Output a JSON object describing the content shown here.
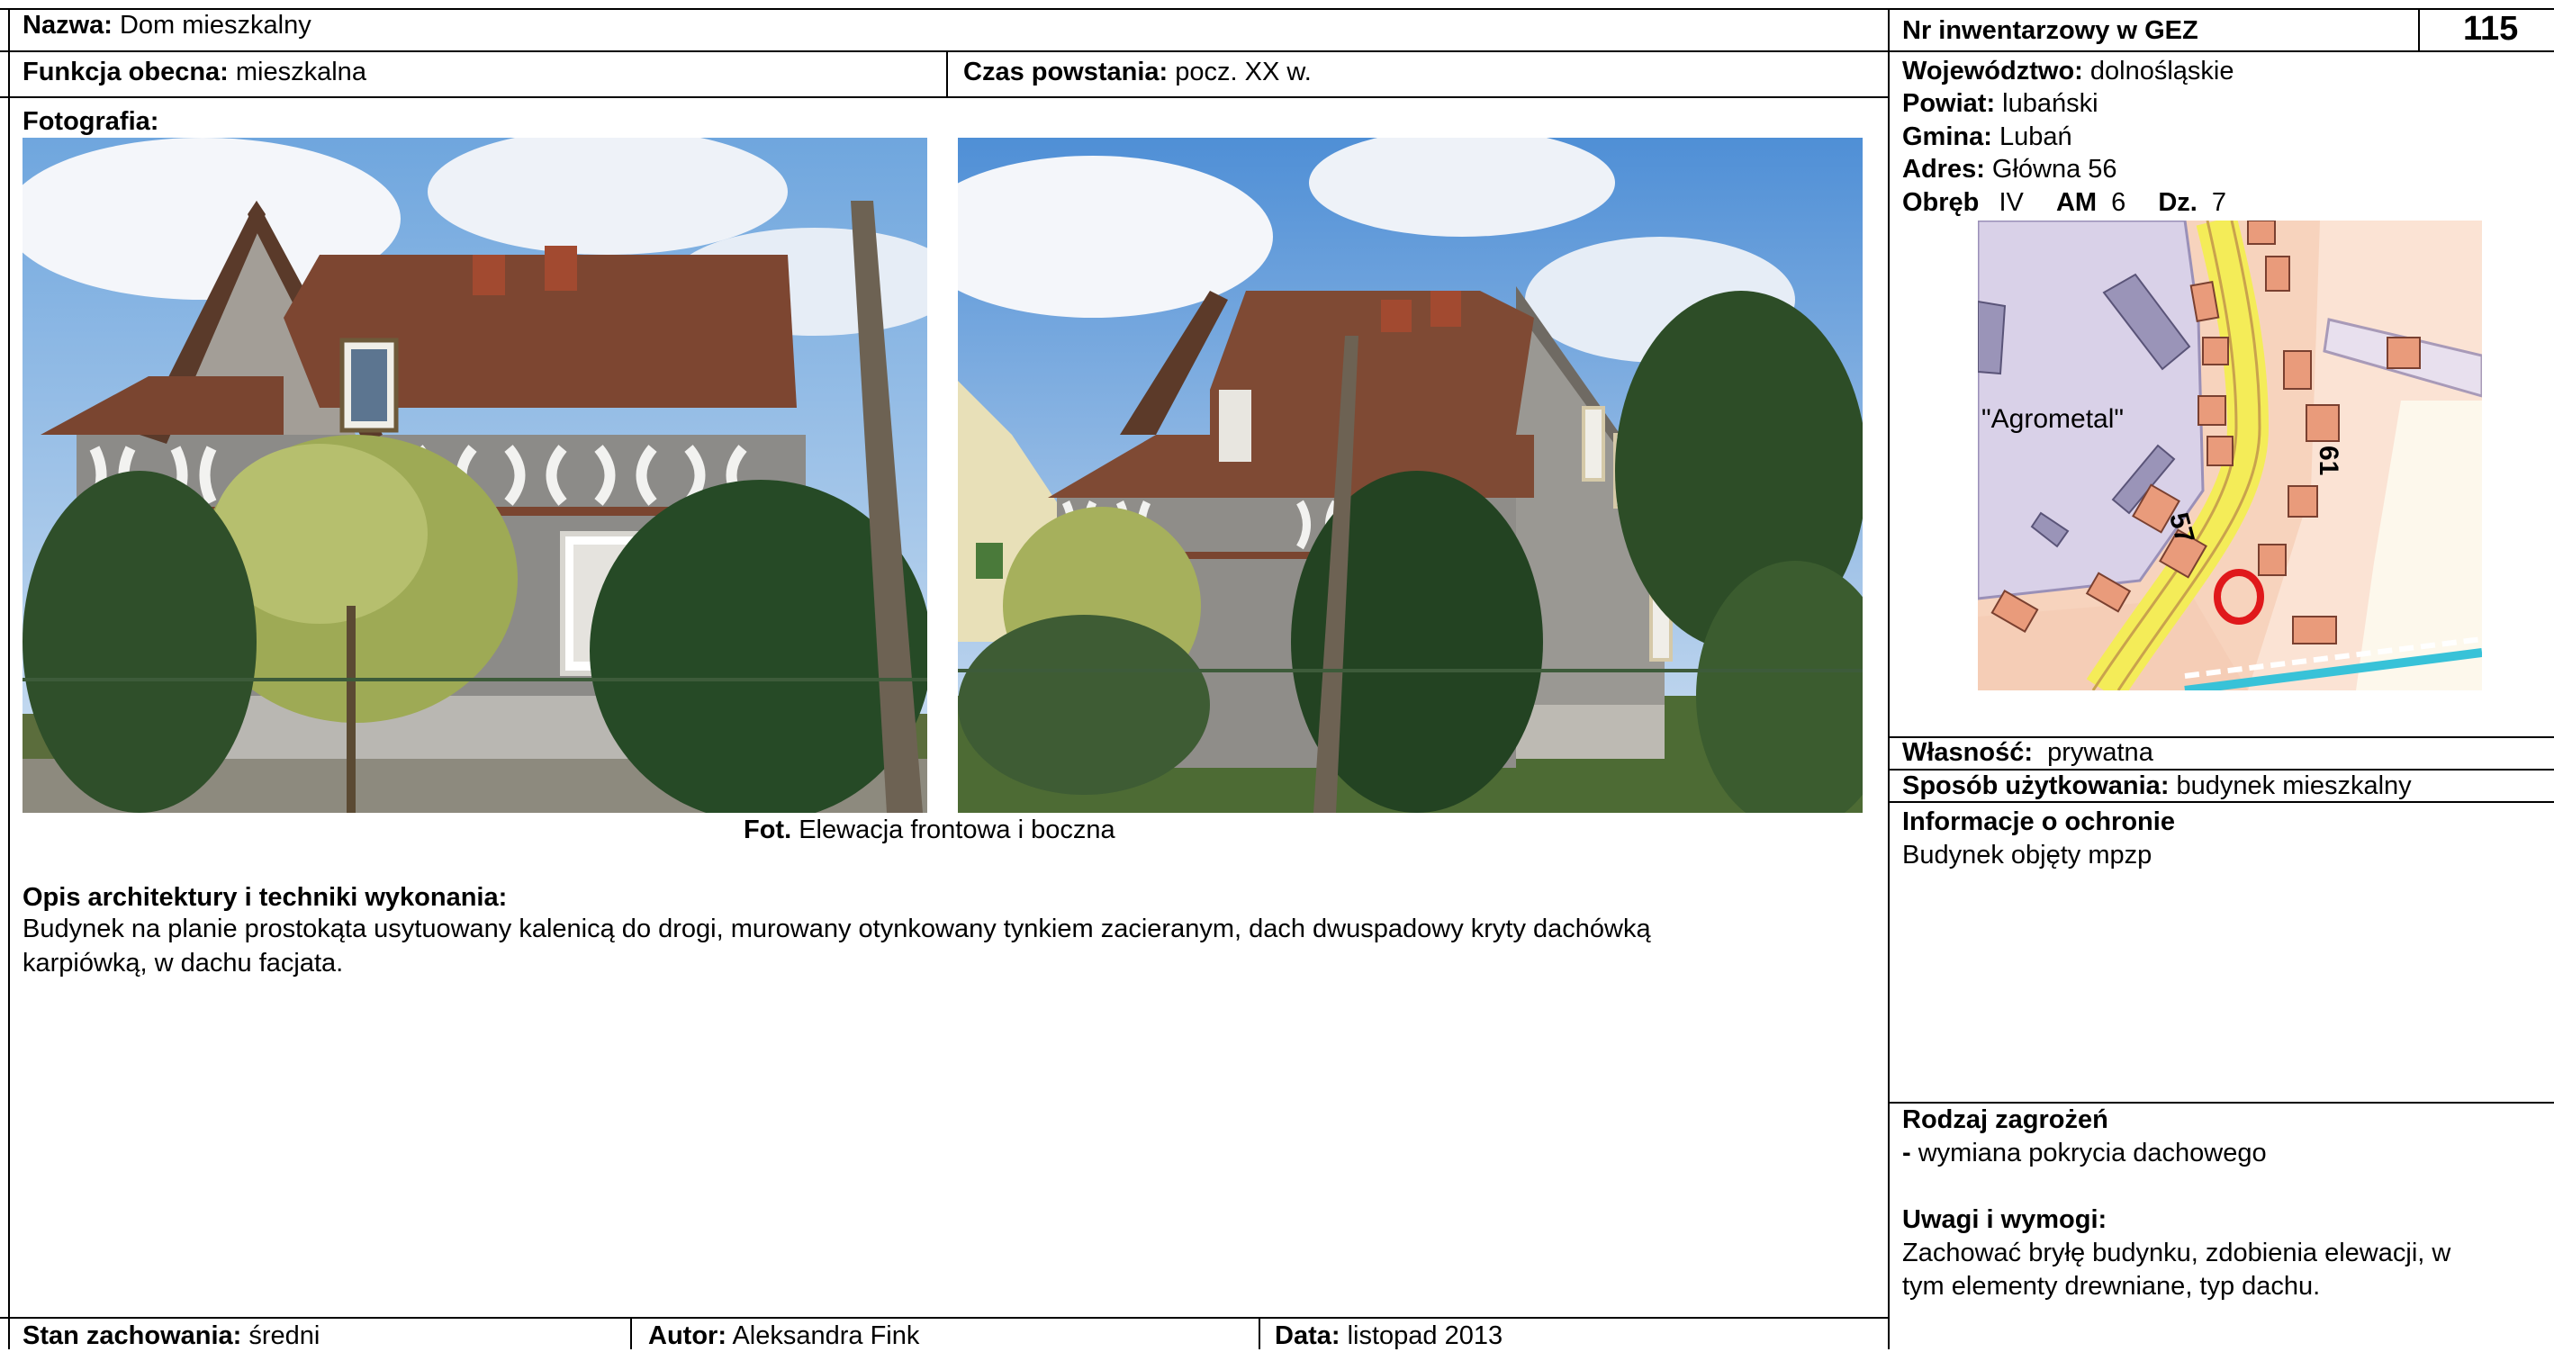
{
  "header": {
    "name_label": "Nazwa:",
    "name_value": " Dom mieszkalny",
    "function_label": "Funkcja obecna:",
    "function_value": " mieszkalna",
    "date_built_label": "Czas powstania:",
    "date_built_value": " pocz. XX w."
  },
  "inventory": {
    "label": "Nr inwentarzowy w GEZ",
    "number": "115"
  },
  "location": {
    "voivodeship_label": "Województwo:",
    "voivodeship_value": " dolnośląskie",
    "county_label": "Powiat:",
    "county_value": " lubański",
    "commune_label": "Gmina:",
    "commune_value": " Lubań",
    "address_label": "Adres:",
    "address_value": " Główna 56",
    "precinct_label": "Obręb",
    "precinct_value": "IV",
    "am_label": "AM",
    "am_value": "6",
    "dz_label": "Dz.",
    "dz_value": "7"
  },
  "map": {
    "area_label": "\"Agrometal\"",
    "house_number_a": "57",
    "house_number_b": "61"
  },
  "photos": {
    "section_label": "Fotografia:",
    "caption_bold": "Fot.",
    "caption_text": " Elewacja frontowa i boczna"
  },
  "description": {
    "label": "Opis architektury i techniki wykonania:",
    "line1": "Budynek na planie prostokąta usytuowany kalenicą do drogi, murowany otynkowany tynkiem zacieranym, dach dwuspadowy kryty dachówką",
    "line2": "karpiówką, w dachu facjata."
  },
  "ownership": {
    "label": "Własność:",
    "value": "  prywatna"
  },
  "usage": {
    "label": "Sposób użytkowania:",
    "value": " budynek mieszkalny"
  },
  "protection": {
    "label": "Informacje o ochronie",
    "value": "Budynek objęty mpzp"
  },
  "threats": {
    "label": "Rodzaj zagrożeń",
    "dash": "-",
    "value": " wymiana pokrycia dachowego"
  },
  "remarks": {
    "label": "Uwagi i wymogi:",
    "line1": "Zachować bryłę budynku, zdobienia elewacji, w",
    "line2": "tym elementy drewniane, typ dachu."
  },
  "footer": {
    "condition_label": "Stan zachowania:",
    "condition_value": " średni",
    "author_label": "Autor:",
    "author_value": " Aleksandra Fink",
    "date_label": "Data:",
    "date_value": " listopad 2013"
  },
  "colors": {
    "map_background": "#f7d3bd",
    "map_road": "#f6ef5c",
    "map_industrial": "#d8d0e8",
    "marker": "#e0181b"
  }
}
